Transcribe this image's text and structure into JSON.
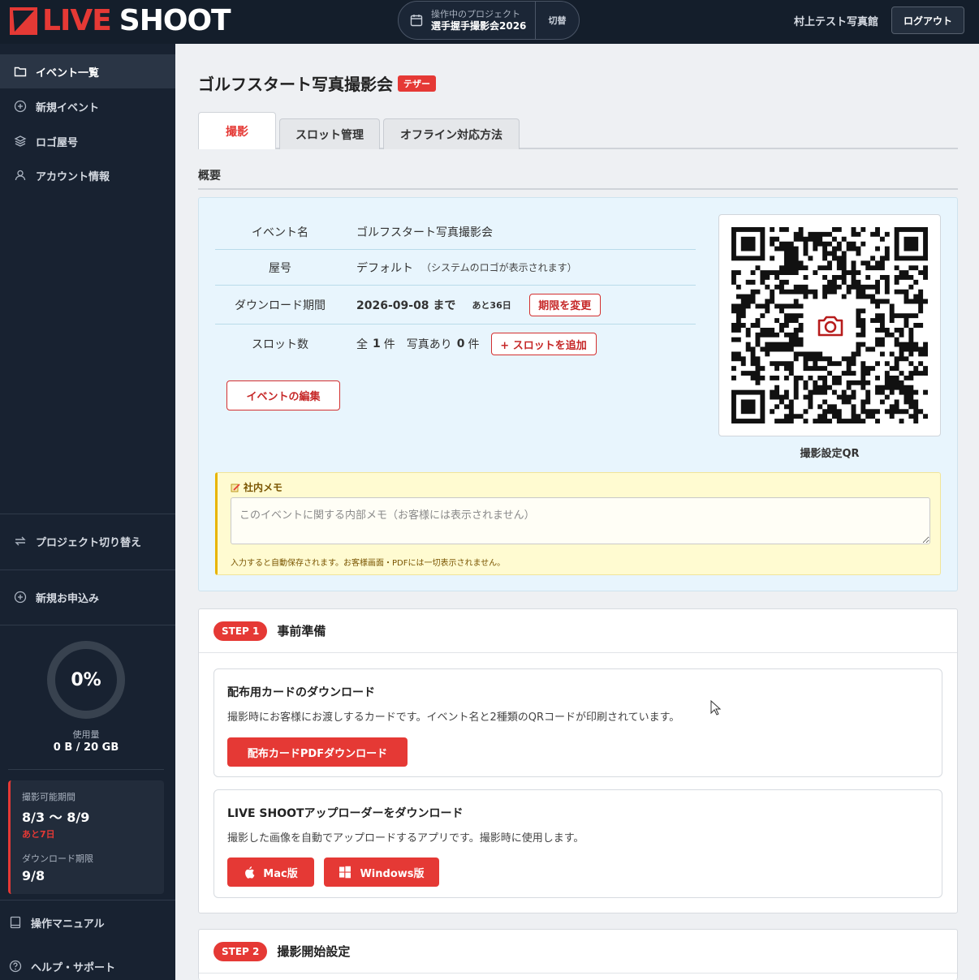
{
  "header": {
    "logo_live": "LIVE",
    "logo_shoot": "SHOOT",
    "project_label": "操作中のプロジェクト",
    "project_name": "選手握手撮影会2026",
    "switch_label": "切替",
    "studio_name": "村上テスト写真館",
    "logout_label": "ログアウト"
  },
  "sidebar": {
    "items": [
      {
        "label": "イベント一覧",
        "icon": "folder-icon",
        "active": true
      },
      {
        "label": "新規イベント",
        "icon": "plus-circle-icon"
      },
      {
        "label": "ロゴ屋号",
        "icon": "layers-icon"
      },
      {
        "label": "アカウント情報",
        "icon": "user-icon"
      }
    ],
    "project_switch": "プロジェクト切り替え",
    "new_application": "新規お申込み",
    "usage": {
      "percent": "0%",
      "percent_value": 0,
      "label": "使用量",
      "value": "0 B / 20 GB"
    },
    "period": {
      "shoot_label": "撮影可能期間",
      "shoot_value": "8/3 〜 8/9",
      "remaining": "あと7日",
      "download_label": "ダウンロード期限",
      "download_value": "9/8"
    },
    "manual": "操作マニュアル",
    "help": "ヘルプ・サポート"
  },
  "main": {
    "title": "ゴルフスタート写真撮影会",
    "badge": "テザー",
    "tabs": [
      {
        "label": "撮影",
        "active": true
      },
      {
        "label": "スロット管理"
      },
      {
        "label": "オフライン対応方法"
      }
    ],
    "section_title": "概要",
    "overview": {
      "event_name_label": "イベント名",
      "event_name": "ゴルフスタート写真撮影会",
      "brand_label": "屋号",
      "brand_value": "デフォルト",
      "brand_note": "（システムのロゴが表示されます）",
      "download_label": "ダウンロード期間",
      "download_value": "2026-09-08 まで",
      "download_remaining": "あと36日",
      "change_deadline": "期限を変更",
      "slots_label": "スロット数",
      "slots_total_prefix": "全",
      "slots_total": "1",
      "slots_total_suffix": "件",
      "slots_photo_prefix": "写真あり",
      "slots_photo": "0",
      "slots_photo_suffix": "件",
      "add_slot": "+ スロットを追加",
      "edit_event": "イベントの編集",
      "qr_label": "撮影設定QR"
    },
    "memo": {
      "title": "社内メモ",
      "placeholder": "このイベントに関する内部メモ（お客様には表示されません）",
      "hint": "入力すると自動保存されます。お客様画面・PDFには一切表示されません。"
    },
    "step1": {
      "pill": "STEP 1",
      "title": "事前準備",
      "card1": {
        "title": "配布用カードのダウンロード",
        "desc": "撮影時にお客様にお渡しするカードです。イベント名と2種類のQRコードが印刷されています。",
        "button": "配布カードPDFダウンロード"
      },
      "card2": {
        "title": "LIVE SHOOTアップローダーをダウンロード",
        "desc": "撮影した画像を自動でアップロードするアプリです。撮影時に使用します。",
        "mac": "Mac版",
        "windows": "Windows版"
      }
    },
    "step2": {
      "pill": "STEP 2",
      "title": "撮影開始設定"
    }
  },
  "colors": {
    "accent": "#e53935",
    "sidebar_bg": "#182231",
    "header_bg": "#141e2b",
    "overview_bg": "#e8f5fd",
    "memo_bg": "#fffbd1"
  }
}
